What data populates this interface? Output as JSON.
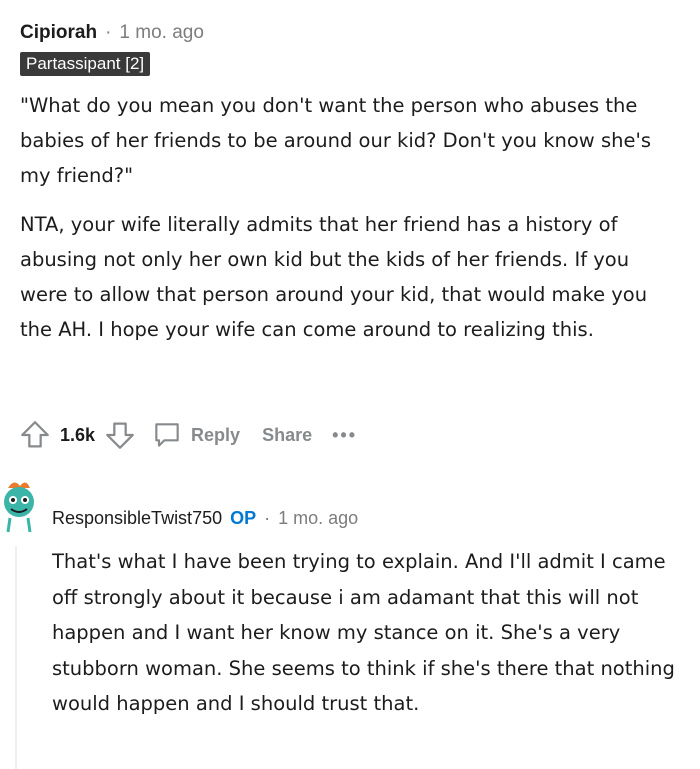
{
  "comment1": {
    "author": "Cipiorah",
    "separator": "·",
    "time": "1 mo. ago",
    "flair": "Partassipant [2]",
    "paragraphs": [
      "\"What do you mean you don't want the person who abuses the babies of her friends to be around our kid? Don't you know she's my friend?\"",
      "NTA, your wife literally admits that her friend has a history of abusing not only her own kid but the kids of her friends. If you were to allow that person around your kid, that would make you the AH. I hope your wife can come around to realizing this."
    ],
    "actions": {
      "votes": "1.6k",
      "reply": "Reply",
      "share": "Share",
      "more": "•••"
    }
  },
  "comment2": {
    "author": "ResponsibleTwist750",
    "op_badge": "OP",
    "separator": "·",
    "time": "1 mo. ago",
    "body": "That's what I have been trying to explain. And I'll admit I came off strongly about it because i am adamant that this will not happen and I want her know my stance on it. She's a very stubborn woman. She seems to think if she's there that nothing would happen and I should trust that."
  },
  "colors": {
    "op": "#0079d3",
    "flair_bg": "#3a3a3a",
    "muted": "#878a8c",
    "avatar_teal": "#3bb5a7",
    "avatar_orange": "#e87b2e"
  }
}
